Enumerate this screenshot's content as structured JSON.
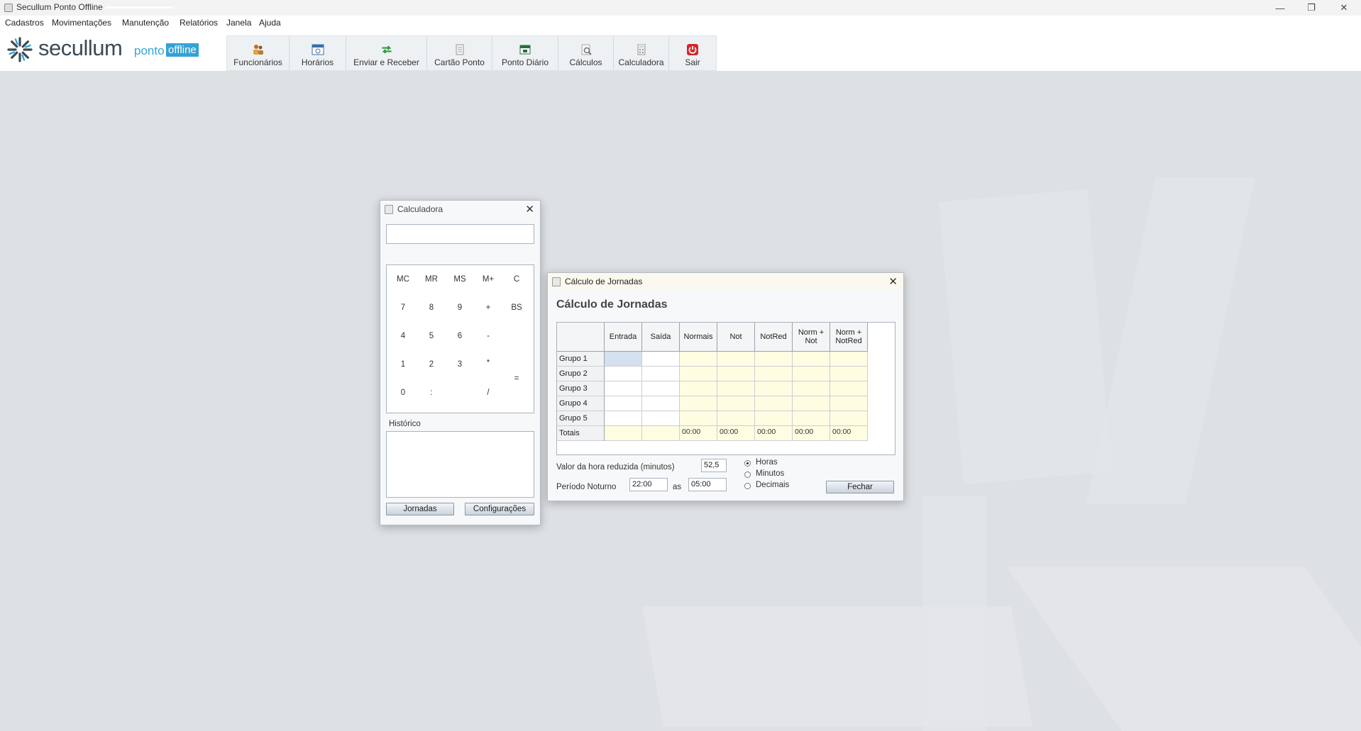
{
  "window": {
    "title": "Secullum Ponto Offline",
    "controls": {
      "minimize": "—",
      "maximize": "❐",
      "close": "✕"
    }
  },
  "menu": [
    "Cadastros",
    "Movimentações",
    "Manutenção",
    "Relatórios",
    "Janela",
    "Ajuda"
  ],
  "logo": {
    "brand": "secullum",
    "sub1": "ponto",
    "sub2": "offline"
  },
  "toolbar": [
    {
      "label": "Funcionários",
      "icon": "employees-icon"
    },
    {
      "label": "Horários",
      "icon": "schedule-icon"
    },
    {
      "label": "Enviar e Receber",
      "icon": "send-receive-icon"
    },
    {
      "label": "Cartão Ponto",
      "icon": "timecard-icon"
    },
    {
      "label": "Ponto Diário",
      "icon": "daily-icon"
    },
    {
      "label": "Cálculos",
      "icon": "calculations-icon"
    },
    {
      "label": "Calculadora",
      "icon": "calculator-icon"
    },
    {
      "label": "Sair",
      "icon": "power-icon"
    }
  ],
  "calculator": {
    "title": "Calculadora",
    "display_value": "",
    "keys": {
      "row1": [
        "MC",
        "MR",
        "MS",
        "M+",
        "C"
      ],
      "row2": [
        "7",
        "8",
        "9",
        "+",
        "BS"
      ],
      "row3": [
        "4",
        "5",
        "6",
        "-"
      ],
      "row4": [
        "1",
        "2",
        "3",
        "*"
      ],
      "row5": [
        "0",
        ":",
        "/"
      ],
      "equals": "="
    },
    "history_label": "Histórico",
    "history_value": "",
    "buttons": {
      "jornadas": "Jornadas",
      "configuracoes": "Configurações"
    }
  },
  "jornadas": {
    "title": "Cálculo de Jornadas",
    "heading": "Cálculo de Jornadas",
    "columns": {
      "entrada": "Entrada",
      "saida": "Saída",
      "normais": "Normais",
      "not": "Not",
      "notred": "NotRed",
      "norm_not_1": "Norm +",
      "norm_not_2": "Not",
      "norm_notred_1": "Norm +",
      "norm_notred_2": "NotRed"
    },
    "rows": [
      "Grupo 1",
      "Grupo 2",
      "Grupo 3",
      "Grupo 4",
      "Grupo 5"
    ],
    "totals_label": "Totais",
    "totals": [
      "00:00",
      "00:00",
      "00:00",
      "00:00",
      "00:00"
    ],
    "hora_reduzida_label": "Valor da hora reduzida (minutos)",
    "hora_reduzida_value": "52,5",
    "periodo_label": "Período Noturno",
    "periodo_start": "22:00",
    "periodo_sep": "as",
    "periodo_end": "05:00",
    "units": {
      "horas": "Horas",
      "minutos": "Minutos",
      "decimais": "Decimais"
    },
    "selected_unit": "Horas",
    "close_button": "Fechar"
  }
}
